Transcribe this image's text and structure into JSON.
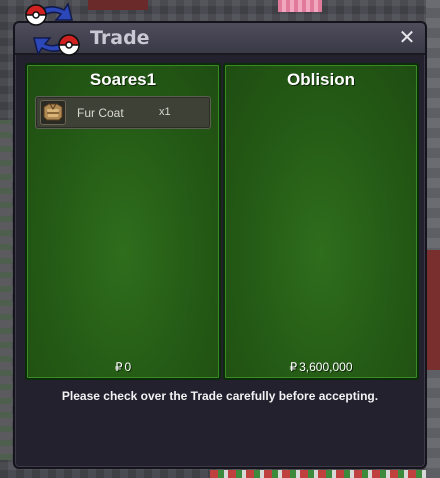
{
  "window": {
    "title": "Trade",
    "close_label": "✕"
  },
  "players": {
    "left": {
      "name": "Soares1",
      "currency_symbol": "₽",
      "money": "0",
      "items": [
        {
          "icon": "fur-coat-icon",
          "name": "Fur Coat",
          "qty": "x1"
        }
      ]
    },
    "right": {
      "name": "Oblision",
      "currency_symbol": "₽",
      "money": "3,600,000",
      "items": []
    }
  },
  "footer": {
    "note": "Please check over the Trade carefully before accepting."
  },
  "colors": {
    "panel_green": "#245a15",
    "window_bg": "#22212d",
    "title_text": "#c9c8d3"
  }
}
